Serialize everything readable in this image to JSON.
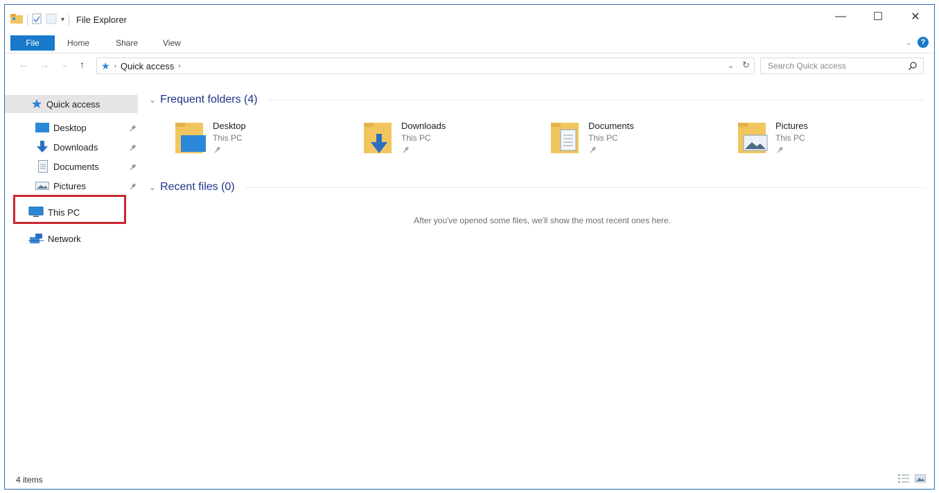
{
  "window": {
    "title": "File Explorer",
    "controls": {
      "minimize": "—",
      "maximize": "☐",
      "close": "✕"
    }
  },
  "ribbon": {
    "tabs": [
      "File",
      "Home",
      "Share",
      "View"
    ],
    "help": "?"
  },
  "address": {
    "location_star": "★",
    "path": "Quick access",
    "search_placeholder": "Search Quick access"
  },
  "nav_pane": {
    "quick_access": "Quick access",
    "pinned": [
      "Desktop",
      "Downloads",
      "Documents",
      "Pictures"
    ],
    "this_pc": "This PC",
    "network": "Network"
  },
  "content": {
    "frequent_heading": "Frequent folders (4)",
    "folders": [
      {
        "name": "Desktop",
        "location": "This PC",
        "icon": "desktop-folder-icon"
      },
      {
        "name": "Downloads",
        "location": "This PC",
        "icon": "downloads-folder-icon"
      },
      {
        "name": "Documents",
        "location": "This PC",
        "icon": "documents-folder-icon"
      },
      {
        "name": "Pictures",
        "location": "This PC",
        "icon": "pictures-folder-icon"
      }
    ],
    "recent_heading": "Recent files (0)",
    "recent_empty_message": "After you've opened some files, we'll show the most recent ones here."
  },
  "status": {
    "item_count": "4 items"
  },
  "colors": {
    "accent": "#1979ca",
    "highlight": "#c8282e",
    "folder": "#f2c65e"
  }
}
